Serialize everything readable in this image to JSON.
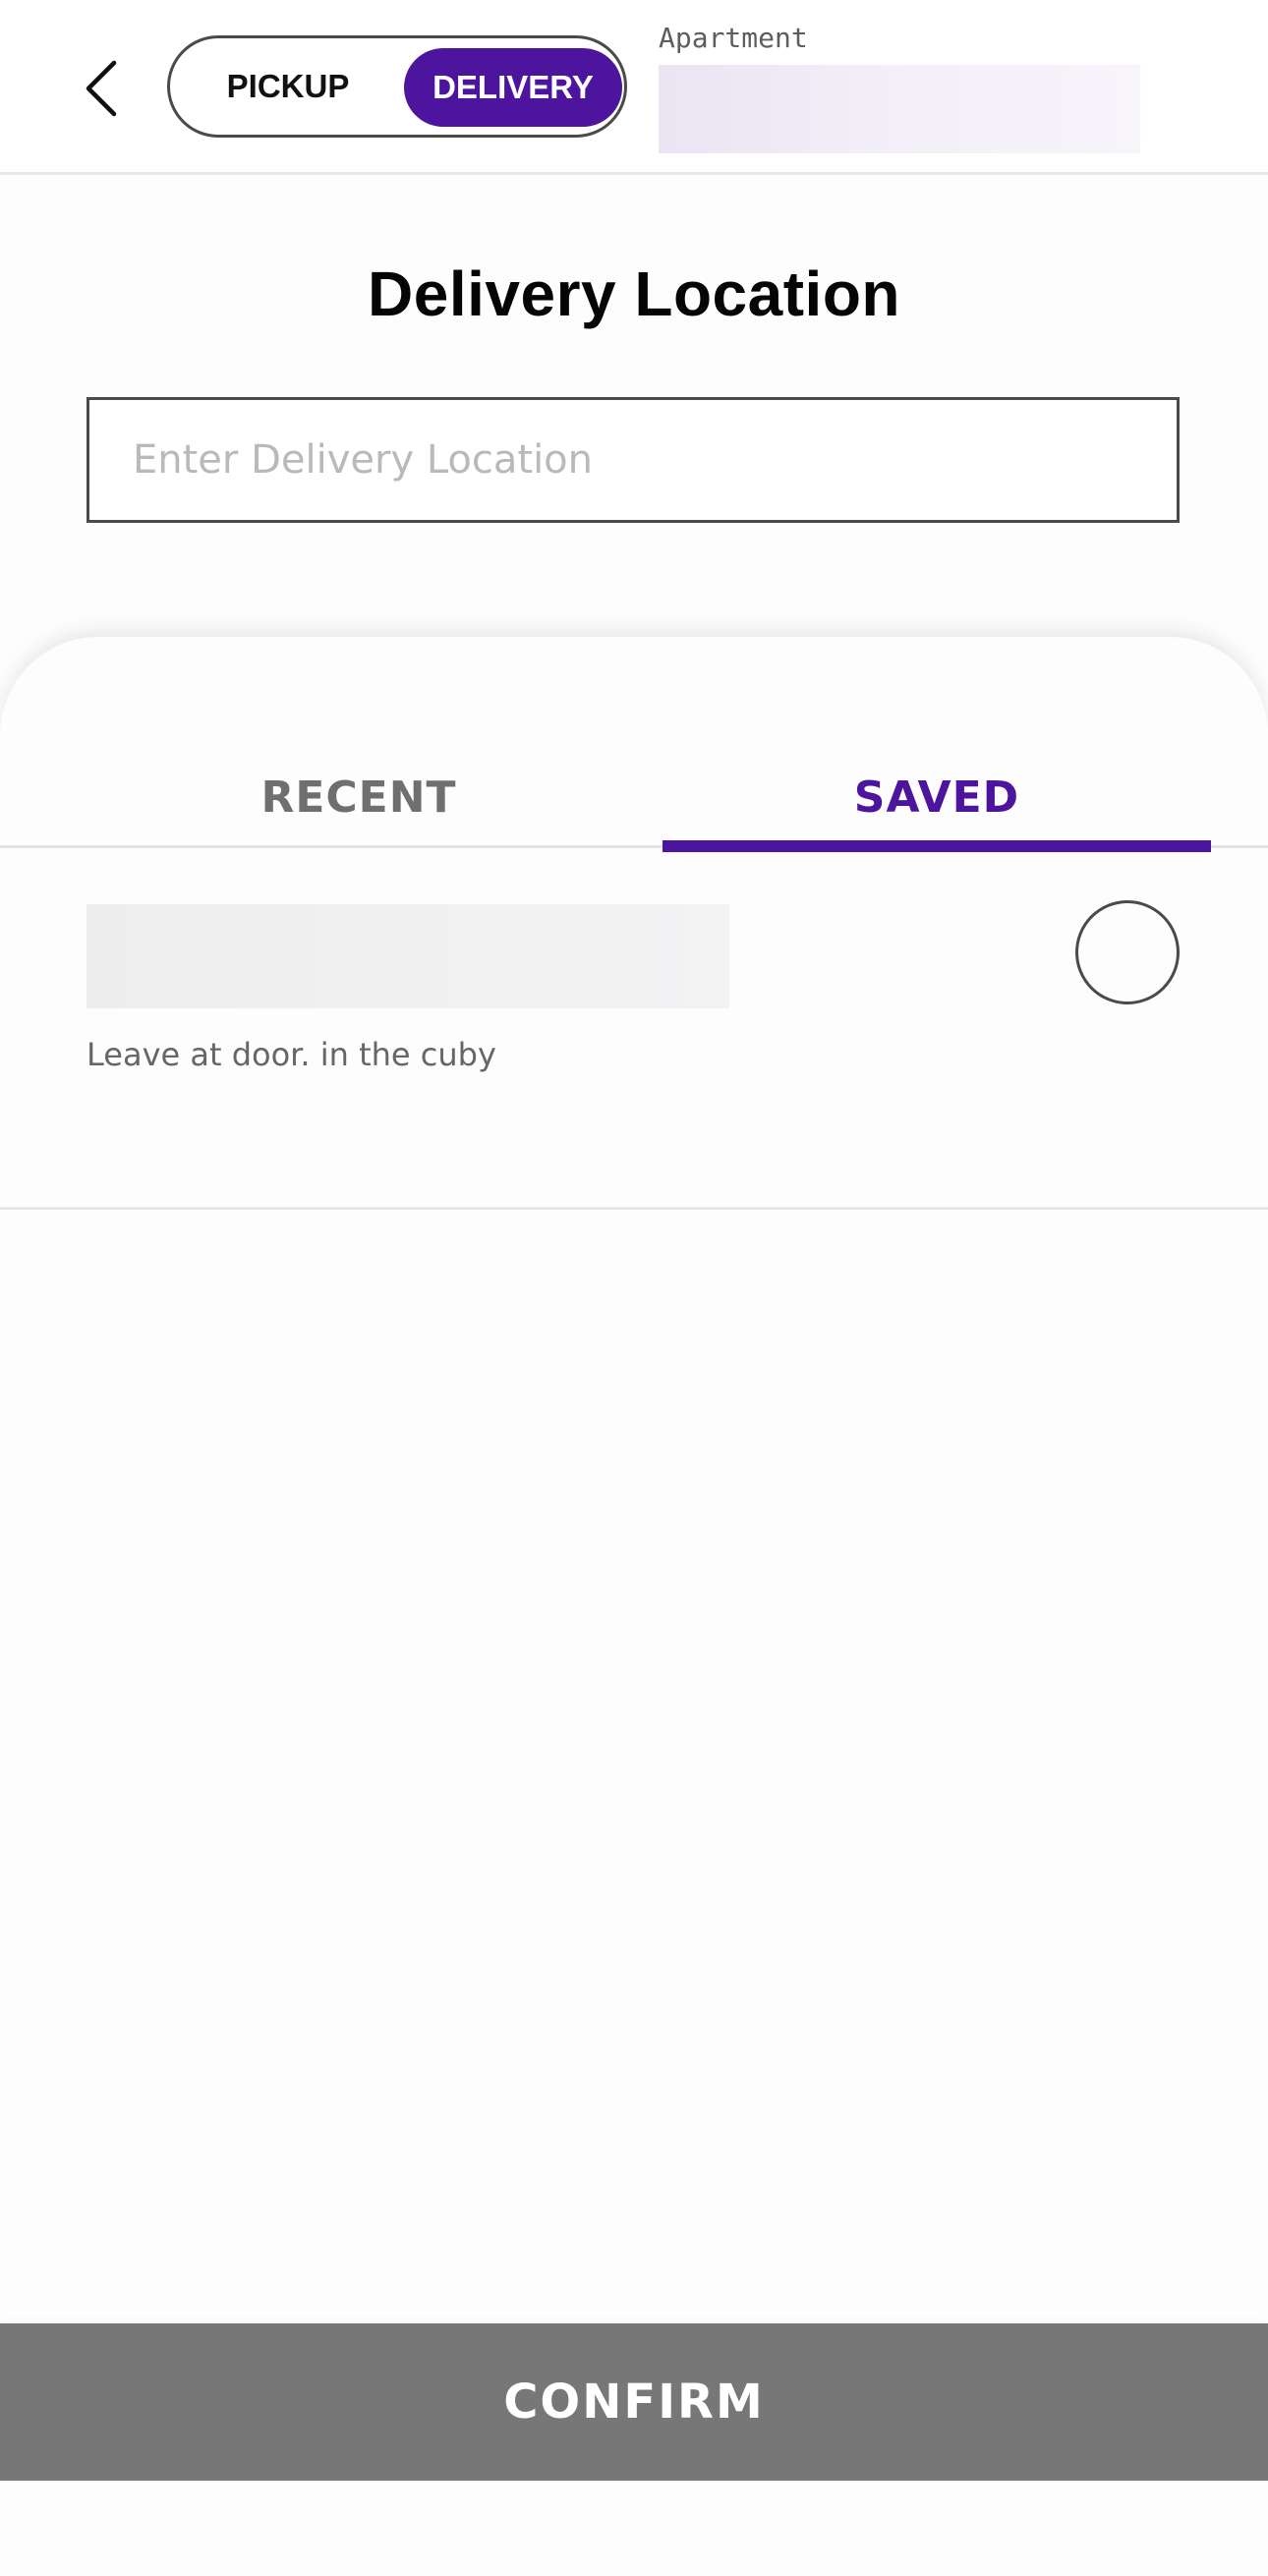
{
  "header": {
    "pickup_label": "PICKUP",
    "delivery_label": "DELIVERY",
    "apartment_label": "Apartment"
  },
  "main": {
    "title": "Delivery Location",
    "search": {
      "placeholder": "Enter Delivery Location",
      "value": ""
    }
  },
  "tabs": {
    "recent_label": "RECENT",
    "saved_label": "SAVED",
    "active": "SAVED"
  },
  "saved": {
    "items": [
      {
        "note": "Leave at door. in the cuby",
        "selected": false
      }
    ]
  },
  "footer": {
    "confirm_label": "CONFIRM"
  },
  "colors": {
    "accent": "#4d149d",
    "confirm_bg": "#777777"
  },
  "icons": {
    "back": "chevron-left-icon",
    "radio": "radio-unselected-icon"
  }
}
